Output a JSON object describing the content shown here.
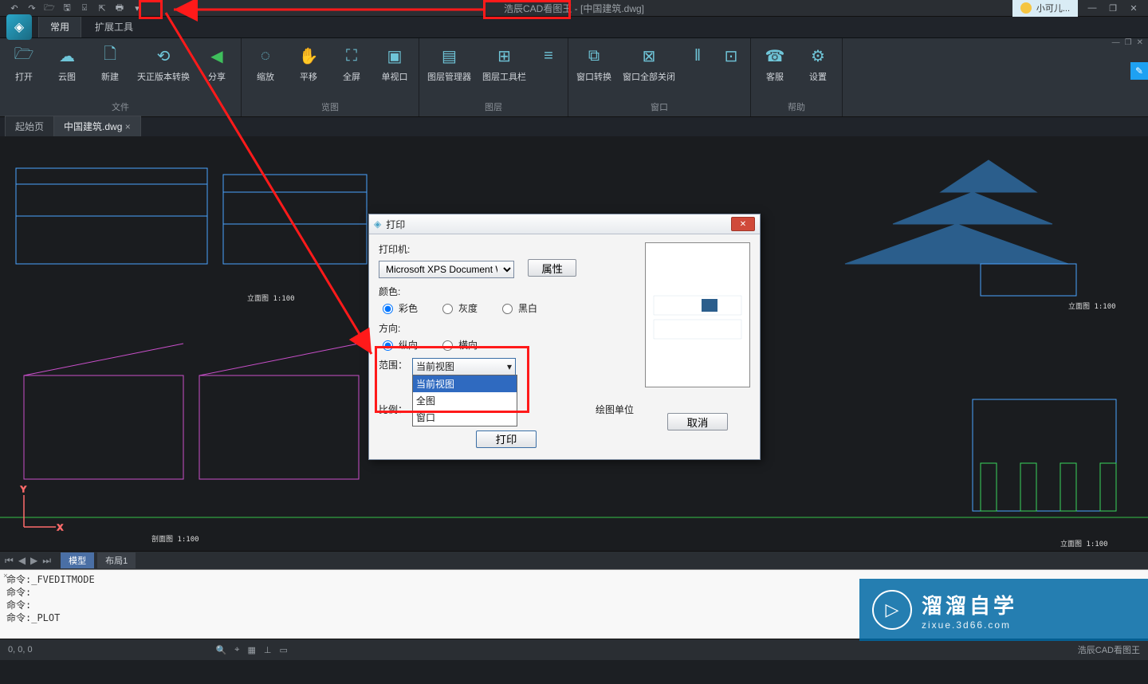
{
  "app": {
    "title_highlight": "浩辰CAD看图王",
    "title_suffix": " - [中国建筑.dwg]",
    "user_name": "小可儿..."
  },
  "menu_tabs": {
    "common": "常用",
    "extend": "扩展工具"
  },
  "ribbon": {
    "file": {
      "label": "文件",
      "open": "打开",
      "cloud": "云图",
      "new": "新建",
      "tz_convert": "天正版本转换",
      "share": "分享"
    },
    "view": {
      "label": "览图",
      "zoom": "缩放",
      "pan": "平移",
      "fullscreen": "全屏",
      "single_vp": "单视口"
    },
    "layer": {
      "label": "图层",
      "mgr": "图层管理器",
      "tools": "图层工具栏"
    },
    "window": {
      "label": "窗口",
      "switch": "窗口转换",
      "close_all": "窗口全部关闭"
    },
    "help": {
      "label": "帮助",
      "support": "客服",
      "settings": "设置"
    }
  },
  "doc_tabs": {
    "start": "起始页",
    "file": "中国建筑.dwg"
  },
  "model_tabs": {
    "model": "模型",
    "layout1": "布局1"
  },
  "cad_labels": {
    "lm1": "立面图",
    "lm1_scale": "1:100",
    "pm": "剖面图",
    "pm_scale": "1:100",
    "lm2": "立面图",
    "lm2_scale": "1:100",
    "lm3": "立面图",
    "lm3_scale": "1:100"
  },
  "dialog": {
    "title": "打印",
    "printer_label": "打印机:",
    "printer_value": "Microsoft XPS Document Writer",
    "properties_btn": "属性",
    "color_label": "颜色:",
    "color_opts": {
      "color": "彩色",
      "gray": "灰度",
      "bw": "黑白"
    },
    "orient_label": "方向:",
    "orient_opts": {
      "portrait": "纵向",
      "landscape": "横向"
    },
    "range_label": "范围：",
    "range_value": "当前视图",
    "range_opts": {
      "current": "当前视图",
      "all": "全图",
      "window": "窗口"
    },
    "scale_label": "比例：",
    "unit_suffix": "绘图单位",
    "print_btn": "打印",
    "cancel_btn": "取消"
  },
  "command": {
    "l1": "命令:_FVEDITMODE",
    "l2": "命令:",
    "l3": "命令:",
    "l4": "命令:_PLOT"
  },
  "status": {
    "coords": "0, 0, 0",
    "brand": "浩辰CAD看图王"
  },
  "watermark": {
    "line1": "溜溜自学",
    "line2": "zixue.3d66.com"
  }
}
